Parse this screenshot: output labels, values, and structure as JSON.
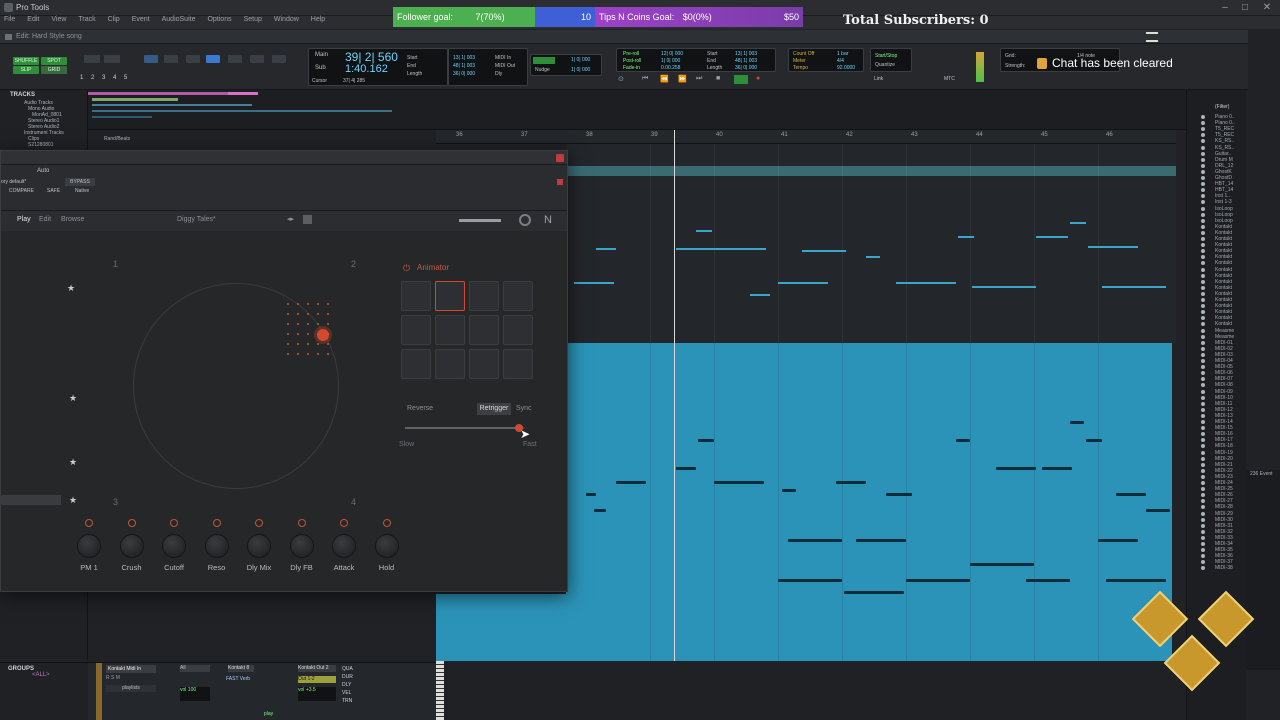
{
  "app": {
    "title": "Pro Tools",
    "menu": [
      "File",
      "Edit",
      "View",
      "Track",
      "Clip",
      "Event",
      "AudioSuite",
      "Options",
      "Setup",
      "Window",
      "Help"
    ],
    "edit_window_title": "Edit: Hard Style song"
  },
  "overlay": {
    "follower_goal_label": "Follower goal:",
    "follower_goal_value": "7(70%)",
    "follower_goal_target": "10",
    "tips_goal_label": "Tips N Coins Goal:",
    "tips_goal_value": "$0(0%)",
    "tips_goal_target": "$50",
    "total_subscribers": "Total Subscribers: 0",
    "chat_notice": "Chat has been cleared",
    "colors": {
      "follower": "#4caf50",
      "follower_rest": "#3f5fd6",
      "tips": "#9c42c8",
      "tips_rest": "#7a3ca8"
    }
  },
  "toolbar": {
    "modes": [
      "SHUFFLE",
      "SPOT",
      "SLIP",
      "GRID"
    ],
    "counters": {
      "main_label": "Main",
      "main_value": "39| 2| 560",
      "sub_label": "Sub",
      "sub_value": "1:40.162",
      "cursor_label": "Cursor",
      "cursor_value": "37| 4| 285",
      "start_label": "Start",
      "end_label": "End",
      "length_label": "Length",
      "start_value": "13| 1| 003",
      "end_value": "48| 1| 003",
      "length_value": "36| 0| 000",
      "midi_in_label": "MIDI In",
      "midi_out_label": "MIDI Out",
      "dly_label": "Dly",
      "nudge_label": "Nudge",
      "nudge_value": "1| 0| 000",
      "grid_value": "1| 0| 000",
      "preroll_label": "Pre-roll",
      "postroll_label": "Post-roll",
      "fadein_label": "Fade-in",
      "preroll_value": "12| 0| 000",
      "postroll_value": "1| 0| 000",
      "fadein_value": "0.00.258",
      "start2_value": "13| 1| 003",
      "end2_value": "48| 1| 003",
      "length2_value": "36| 0| 000",
      "count_off_label": "Count Off",
      "meter_label": "Meter",
      "tempo_label": "Tempo",
      "meter_value": "4/4",
      "tempo_value": "92.0000",
      "bar_value": "1 bar",
      "link_label": "Link",
      "mtc_label": "MTC",
      "start_stop_label": "Start/Stop",
      "quantize_label": "Quantize",
      "grid_label": "Grid:",
      "strength_label": "Strength:",
      "grid_note": "1/4 note"
    }
  },
  "tracks_pane": {
    "header": "TRACKS",
    "items": [
      "Audio Tracks",
      "Mono Audio",
      "MonAd_0801",
      "Stereo Audio1",
      "Stereo Audio2",
      "Instrument Tracks",
      "Clips",
      "S21280801"
    ]
  },
  "groups_pane": {
    "header": "GROUPS",
    "item": "<ALL>"
  },
  "ruler": {
    "track_name": "Rand/Beats",
    "bars": [
      "36",
      "37",
      "38",
      "39",
      "40",
      "41",
      "42",
      "43",
      "44",
      "45",
      "46"
    ]
  },
  "plugin": {
    "preset_prefix": "ory default*",
    "auto_label": "Auto",
    "bypass_label": "BYPASS",
    "compare_label": "COMPARE",
    "safe_label": "SAFE",
    "native_label": "Native",
    "nav": [
      "Play",
      "Edit",
      "Browse"
    ],
    "preset_name": "Diggy Tales*",
    "corners": [
      "1",
      "2",
      "3",
      "4"
    ],
    "animator_label": "Animator",
    "reverse_label": "Reverse",
    "retrigger_label": "Retrigger",
    "sync_label": "Sync",
    "slow_label": "Slow",
    "fast_label": "Fast",
    "speed": 0.95,
    "knobs": [
      "PM 1",
      "Crush",
      "Cutoff",
      "Reso",
      "Dly Mix",
      "Dly FB",
      "Attack",
      "Hold"
    ]
  },
  "regions_list": {
    "filter_label": "(Filter)",
    "items": [
      "Piano 0..",
      "Piano 0..",
      "T5_REC",
      "T5_REC",
      "KS_RS..",
      "KS_RS..",
      "Guitar..",
      "Drum M",
      "DRL_12",
      "GhostK",
      "GhostD",
      "HBT_14",
      "HBT_14",
      "Inst 1..",
      "Inst 1-3",
      "IsoLoop",
      "IsoLoop",
      "IsoLoop",
      "Kontakt",
      "Kontakt",
      "Kontakt",
      "Kontakt",
      "Kontakt",
      "Kontakt",
      "Kontakt",
      "Kontakt",
      "Kontakt",
      "Kontakt",
      "Kontakt",
      "Kontakt",
      "Kontakt",
      "Kontakt",
      "Kontakt",
      "Kontakt",
      "Kontakt",
      "Measme",
      "Measme",
      "MIDI-01",
      "MIDI-02",
      "MIDI-03",
      "MIDI-04",
      "MIDI-05",
      "MIDI-06",
      "MIDI-07",
      "MIDI-08",
      "MIDI-09",
      "MIDI-10",
      "MIDI-11",
      "MIDI-12",
      "MIDI-13",
      "MIDI-14",
      "MIDI-15",
      "MIDI-16",
      "MIDI-17",
      "MIDI-18",
      "MIDI-19",
      "MIDI-20",
      "MIDI-21",
      "MIDI-22",
      "MIDI-23",
      "MIDI-24",
      "MIDI-25",
      "MIDI-26",
      "MIDI-27",
      "MIDI-28",
      "MIDI-29",
      "MIDI-30",
      "MIDI-31",
      "MIDI-32",
      "MIDI-33",
      "MIDI-34",
      "MIDI-35",
      "MIDI-36",
      "MIDI-37",
      "MIDI-38"
    ],
    "event_list_label": "236 Event"
  },
  "mixer": {
    "insert_name": "Kontakt Midi In",
    "playlists_label": "playlists",
    "bus_label": "Kontakt 8",
    "send_label": "FAST Verb",
    "out_label": "Kontakt Out 2",
    "out2_label": "Out 1-2",
    "vol_label": "vol",
    "vol_value": "+3.5",
    "pan_value": "100",
    "play_label": "play",
    "dyn_labels": [
      "QUA",
      "DUR",
      "DLY",
      "VEL",
      "TRN"
    ]
  }
}
